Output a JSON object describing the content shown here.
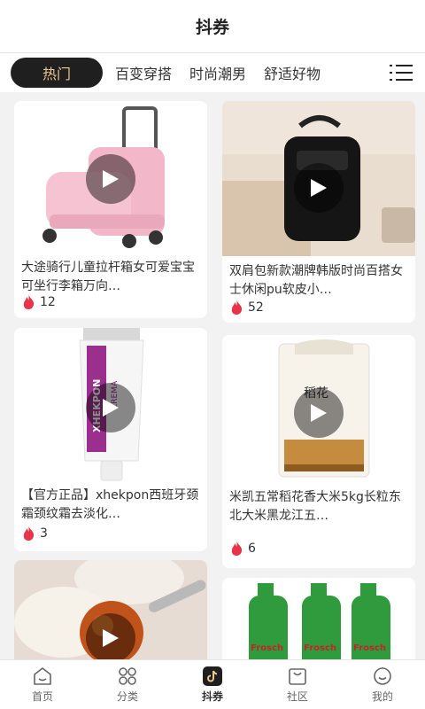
{
  "header": {
    "title": "抖券"
  },
  "tabs": [
    {
      "label": "热门",
      "active": true
    },
    {
      "label": "百变穿搭"
    },
    {
      "label": "时尚潮男"
    },
    {
      "label": "舒适好物"
    }
  ],
  "products": [
    {
      "title": "大途骑行儿童拉杆箱女可爱宝宝可坐行李箱万向…",
      "likes": "12"
    },
    {
      "title": "双肩包新款潮牌韩版时尚百搭女士休闲pu软皮小…",
      "likes": "52"
    },
    {
      "title": "【官方正品】xhekpon西班牙颈霜颈纹霜去淡化…",
      "likes": "3"
    },
    {
      "title": "米凯五常稻花香大米5kg长粒东北大米黑龙江五…",
      "likes": "6"
    }
  ],
  "image_text": {
    "tube_brand": "XHEKPON",
    "tube_sub": "CREMA",
    "rice_cn": "稻花",
    "bottle_brand": "Frosch"
  },
  "bottom_nav": [
    {
      "label": "首页",
      "icon": "home-icon"
    },
    {
      "label": "分类",
      "icon": "grid-icon"
    },
    {
      "label": "抖券",
      "icon": "douyin-icon",
      "active": true
    },
    {
      "label": "社区",
      "icon": "bag-icon"
    },
    {
      "label": "我的",
      "icon": "smile-icon"
    }
  ],
  "colors": {
    "tab_active_bg": "#1f1f1f",
    "tab_active_text": "#e9c98f",
    "flame": "#e8334a"
  }
}
